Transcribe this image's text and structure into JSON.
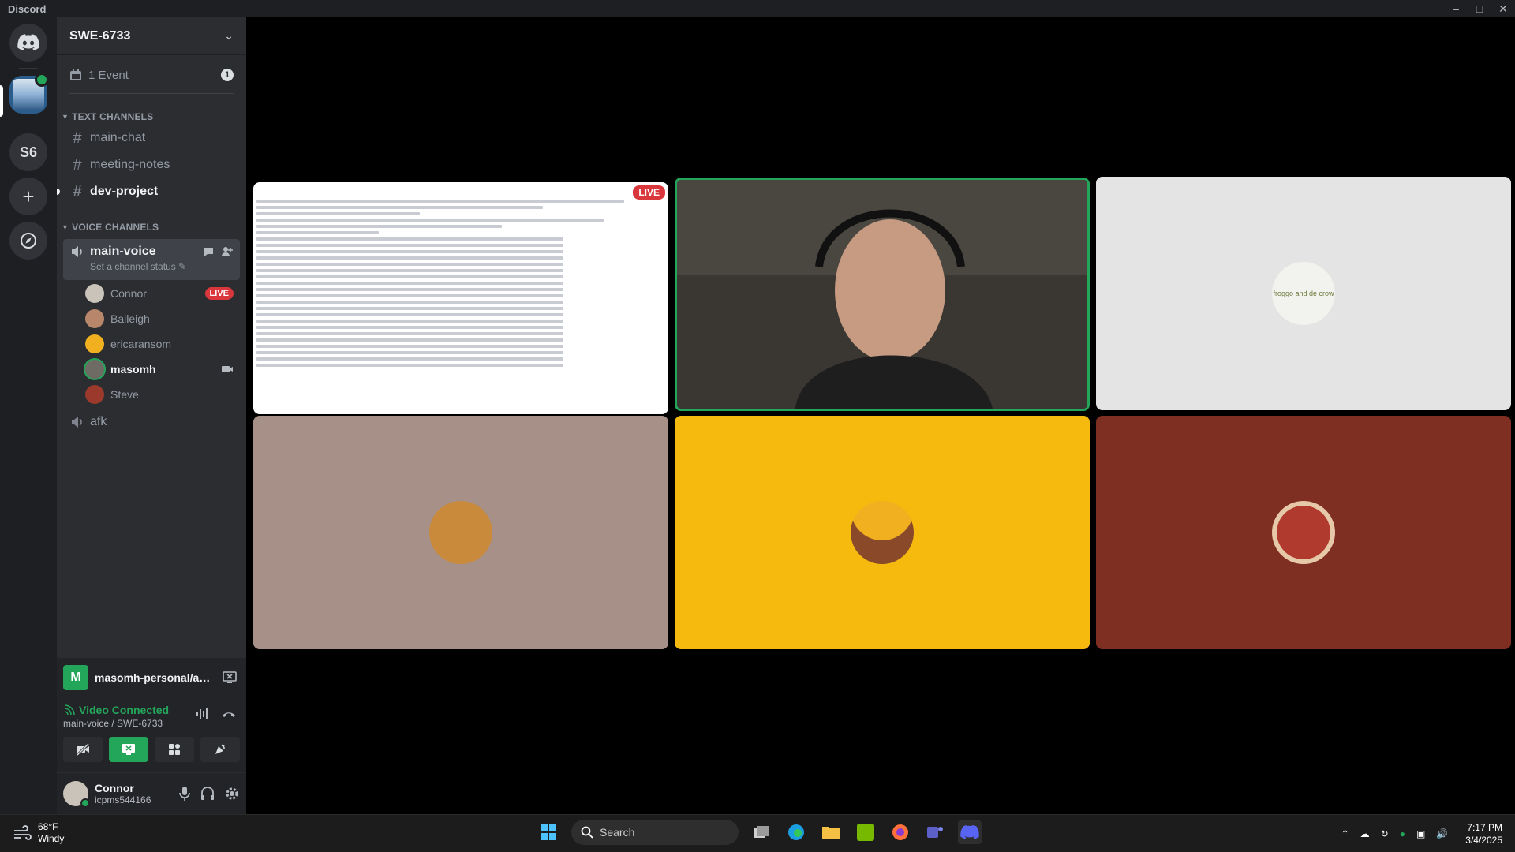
{
  "window": {
    "title": "Discord"
  },
  "guilds": {
    "s6_label": "S6",
    "add_label": "+"
  },
  "server": {
    "name": "SWE-6733",
    "events_label": "1 Event",
    "events_count": "1"
  },
  "text_channels": {
    "category": "TEXT CHANNELS",
    "items": [
      {
        "name": "main-chat"
      },
      {
        "name": "meeting-notes"
      },
      {
        "name": "dev-project"
      }
    ]
  },
  "voice_channels": {
    "category": "VOICE CHANNELS",
    "active": {
      "name": "main-voice",
      "status": "Set a channel status"
    },
    "members": [
      {
        "name": "Connor",
        "badge": "LIVE",
        "avatar_color": "#c9c3b9"
      },
      {
        "name": "Baileigh",
        "avatar_color": "#b8876b"
      },
      {
        "name": "ericaransom",
        "avatar_color": "#f0b020"
      },
      {
        "name": "masomh",
        "avatar_color": "#6e6a64"
      },
      {
        "name": "Steve",
        "avatar_color": "#9b3a2c"
      }
    ],
    "afk": "afk"
  },
  "stream_panel": {
    "app_letter": "M",
    "title": "masomh-personal/adv..."
  },
  "rtc": {
    "status": "Video Connected",
    "channel": "main-voice / SWE-6733"
  },
  "user": {
    "name": "Connor",
    "tag": "icpms544166"
  },
  "stage": {
    "live_label": "LIVE",
    "tile_colors": [
      "#ffffff",
      "#3a3733",
      "#e4e4e4",
      "#a69087",
      "#f6b90e",
      "#7f2e22"
    ],
    "tile3_caption": "froggo and de crow"
  },
  "taskbar": {
    "temp": "68°F",
    "condition": "Windy",
    "search_placeholder": "Search",
    "time": "7:17 PM",
    "date": "3/4/2025"
  }
}
